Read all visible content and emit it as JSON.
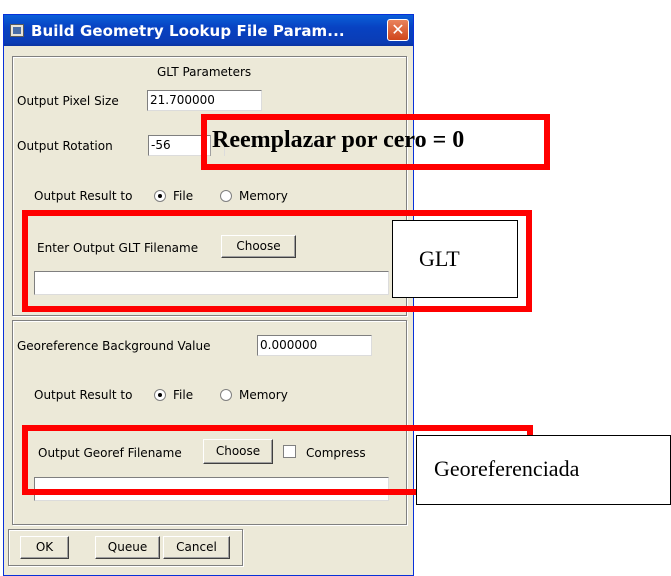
{
  "window": {
    "title": "Build Geometry Lookup File Param...",
    "close_glyph": "✕"
  },
  "glt_params": {
    "heading": "GLT Parameters",
    "pixel_size_label": "Output Pixel Size",
    "pixel_size_value": "21.700000",
    "rotation_label": "Output Rotation",
    "rotation_value": "-56",
    "output_result_label": "Output Result to",
    "option_file": "File",
    "option_memory": "Memory",
    "selected_option": "File",
    "filename_label": "Enter Output GLT Filename",
    "choose_label": "Choose",
    "filename_value": ""
  },
  "georef": {
    "background_label": "Georeference Background Value",
    "background_value": "0.000000",
    "output_result_label": "Output Result to",
    "option_file": "File",
    "option_memory": "Memory",
    "selected_option": "File",
    "filename_label": "Output Georef Filename",
    "choose_label": "Choose",
    "compress_label": "Compress",
    "compress_checked": false,
    "filename_value": ""
  },
  "buttons": {
    "ok": "OK",
    "queue": "Queue",
    "cancel": "Cancel"
  },
  "annotations": {
    "rotation_note": "Reemplazar por cero = 0",
    "glt_callout": "GLT",
    "georef_callout": "Georeferenciada",
    "highlight_color": "#ff0000"
  },
  "icons": {
    "title": "window-app-icon",
    "close": "close-icon",
    "spin": "spinner-arrows-icon"
  }
}
